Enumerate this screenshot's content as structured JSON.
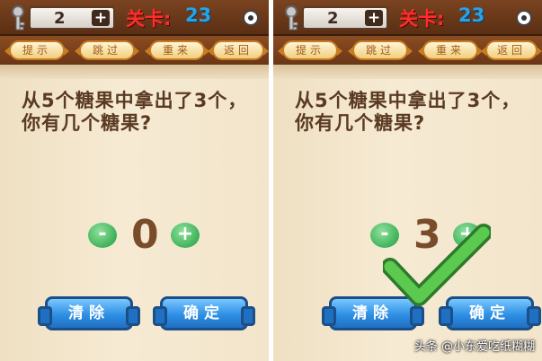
{
  "panels": [
    {
      "key_count": "2",
      "plus_symbol": "+",
      "level_label": "关卡:",
      "level_number": "23",
      "menu": [
        "提示",
        "跳过",
        "重来",
        "返回"
      ],
      "question_line1": "从5个糖果中拿出了3个，",
      "question_line2": "你有几个糖果?",
      "minus_symbol": "-",
      "value": "0",
      "plus_button_symbol": "+",
      "clear_label": "清除",
      "confirm_label": "确定"
    },
    {
      "key_count": "2",
      "plus_symbol": "+",
      "level_label": "关卡:",
      "level_number": "23",
      "menu": [
        "提示",
        "跳过",
        "重来",
        "返回"
      ],
      "question_line1": "从5个糖果中拿出了3个，",
      "question_line2": "你有几个糖果?",
      "minus_symbol": "-",
      "value": "3",
      "plus_button_symbol": "+",
      "clear_label": "清除",
      "confirm_label": "确定",
      "result": "correct"
    }
  ],
  "watermark": "头条 @小东爱吃纸糊糊",
  "colors": {
    "level_label": "#ff2d2d",
    "level_number": "#27a3e8",
    "button_blue": "#2e8fe4",
    "button_green": "#3fb25a",
    "check_green": "#4bb543"
  },
  "icons": [
    "key-icon",
    "target-icon",
    "checkmark-icon"
  ]
}
